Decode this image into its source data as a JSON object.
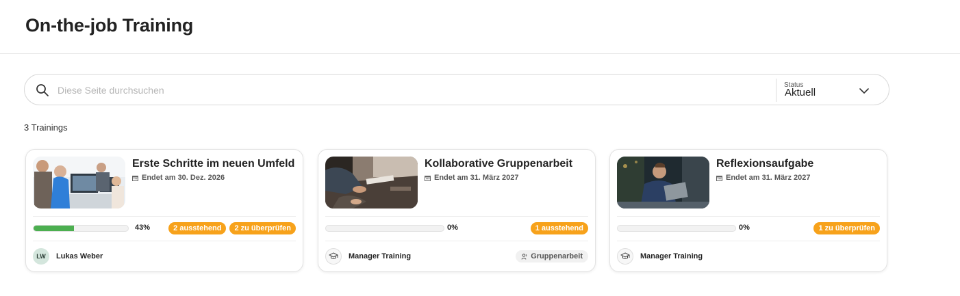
{
  "header": {
    "title": "On-the-job Training"
  },
  "search": {
    "placeholder": "Diese Seite durchsuchen",
    "value": ""
  },
  "status_filter": {
    "label": "Status",
    "value": "Aktuell"
  },
  "count_label": "3 Trainings",
  "colors": {
    "accent_badge": "#f7a21b",
    "progress": "#4caf50"
  },
  "trainings": [
    {
      "title": "Erste Schritte im neuen Umfeld",
      "end_date": "Endet am 30. Dez. 2026",
      "progress_percent": 43,
      "progress_label": "43%",
      "badges": [
        "2 ausstehend",
        "2 zu überprüfen"
      ],
      "owner": {
        "initials": "LW",
        "name": "Lukas Weber"
      },
      "image": "office-team-at-computers"
    },
    {
      "title": "Kollaborative Gruppenarbeit",
      "end_date": "Endet am 31. März 2027",
      "progress_percent": 0,
      "progress_label": "0%",
      "badges": [
        "1 ausstehend"
      ],
      "owner": {
        "icon": "graduation-cap-icon",
        "name": "Manager Training"
      },
      "type": {
        "icon": "group-icon",
        "label": "Gruppenarbeit"
      },
      "image": "meeting-table-with-hands"
    },
    {
      "title": "Reflexionsaufgabe",
      "end_date": "Endet am 31. März 2027",
      "progress_percent": 0,
      "progress_label": "0%",
      "badges": [
        "1 zu überprüfen"
      ],
      "owner": {
        "icon": "graduation-cap-icon",
        "name": "Manager Training"
      },
      "image": "man-with-laptop-outdoors"
    }
  ]
}
